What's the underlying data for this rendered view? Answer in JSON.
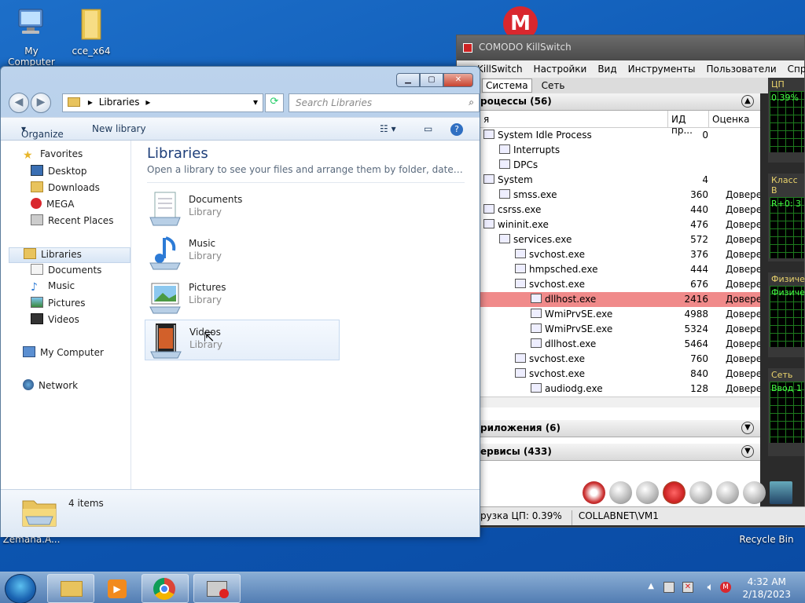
{
  "desktop": {
    "icons": [
      {
        "label": "My Computer"
      },
      {
        "label": "cce_x64"
      },
      {
        "label": "Zemana.A..."
      },
      {
        "label": "Recycle Bin"
      }
    ]
  },
  "killswitch": {
    "title": "COMODO KillSwitch",
    "menu": [
      "KillSwitch",
      "Настройки",
      "Вид",
      "Инструменты",
      "Пользователи",
      "Справка"
    ],
    "tabs": [
      "Система",
      "Сеть"
    ],
    "sections": {
      "processes": "роцессы (56)",
      "applications": "риложения (6)",
      "services": "ервисы (433)"
    },
    "columns": {
      "name": "я",
      "pid": "ИД пр...",
      "rating": "Оценка"
    },
    "processes": [
      {
        "name": "System Idle Process",
        "pid": "0",
        "trust": ""
      },
      {
        "name": "Interrupts",
        "pid": "",
        "trust": ""
      },
      {
        "name": "DPCs",
        "pid": "",
        "trust": ""
      },
      {
        "name": "System",
        "pid": "4",
        "trust": ""
      },
      {
        "name": "smss.exe",
        "pid": "360",
        "trust": "Доверен"
      },
      {
        "name": "csrss.exe",
        "pid": "440",
        "trust": "Доверен"
      },
      {
        "name": "wininit.exe",
        "pid": "476",
        "trust": "Доверен"
      },
      {
        "name": "services.exe",
        "pid": "572",
        "trust": "Доверен"
      },
      {
        "name": "svchost.exe",
        "pid": "376",
        "trust": "Доверен"
      },
      {
        "name": "hmpsched.exe",
        "pid": "444",
        "trust": "Доверен"
      },
      {
        "name": "svchost.exe",
        "pid": "676",
        "trust": "Доверен"
      },
      {
        "name": "dllhost.exe",
        "pid": "2416",
        "trust": "Доверен"
      },
      {
        "name": "WmiPrvSE.exe",
        "pid": "4988",
        "trust": "Доверен"
      },
      {
        "name": "WmiPrvSE.exe",
        "pid": "5324",
        "trust": "Доверен"
      },
      {
        "name": "dllhost.exe",
        "pid": "5464",
        "trust": "Доверен"
      },
      {
        "name": "svchost.exe",
        "pid": "760",
        "trust": "Доверен"
      },
      {
        "name": "svchost.exe",
        "pid": "840",
        "trust": "Доверен"
      },
      {
        "name": "audiodg.exe",
        "pid": "128",
        "trust": "Доверен"
      }
    ],
    "monitors": {
      "cpu_label": "ЦП",
      "cpu_value": "0.39%",
      "class_label": "Класс В",
      "class_value": "R+0: 3",
      "phys_label": "Физиче",
      "phys_value": "Физиче",
      "net_label": "Сеть",
      "net_value": "Ввод 1"
    },
    "status": {
      "cpu": "рузка ЦП: 0.39%",
      "host": "COLLABNET\\VM1"
    }
  },
  "explorer": {
    "address": "Libraries",
    "search_placeholder": "Search Libraries",
    "commands": {
      "organize": "Organize",
      "new_library": "New library"
    },
    "nav": {
      "favorites": "Favorites",
      "desktop": "Desktop",
      "downloads": "Downloads",
      "mega": "MEGA",
      "recent": "Recent Places",
      "libraries": "Libraries",
      "documents": "Documents",
      "music": "Music",
      "pictures": "Pictures",
      "videos": "Videos",
      "computer": "My Computer",
      "network": "Network"
    },
    "main": {
      "title": "Libraries",
      "subtitle": "Open a library to see your files and arrange them by folder, date, and ot...",
      "libraries": [
        {
          "name": "Documents",
          "type": "Library"
        },
        {
          "name": "Music",
          "type": "Library"
        },
        {
          "name": "Pictures",
          "type": "Library"
        },
        {
          "name": "Videos",
          "type": "Library"
        }
      ]
    },
    "details": {
      "count": "4 items"
    }
  },
  "taskbar": {
    "time": "4:32 AM",
    "date": "2/18/2023"
  }
}
